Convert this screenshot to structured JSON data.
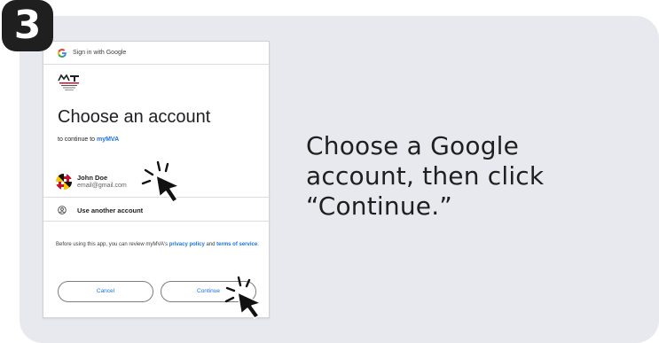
{
  "step_number": "3",
  "instruction": "Choose a Google account, then click “Continue.”",
  "dialog": {
    "header": "Sign in with Google",
    "title": "Choose an account",
    "subtitle_prefix": "to continue to ",
    "app_name": "myMVA",
    "account": {
      "name": "John Doe",
      "email": "email@gmail.com"
    },
    "use_another": "Use another account",
    "legal": {
      "prefix": "Before using this app, you can review myMVA's ",
      "privacy": "privacy policy",
      "and": " and",
      "terms": "terms of service",
      "suffix": "."
    },
    "cancel_label": "Cancel",
    "continue_label": "Continue"
  },
  "colors": {
    "card": "#e8e9ee",
    "badge": "#1f1f1f",
    "link_blue": "#1a73e8"
  }
}
